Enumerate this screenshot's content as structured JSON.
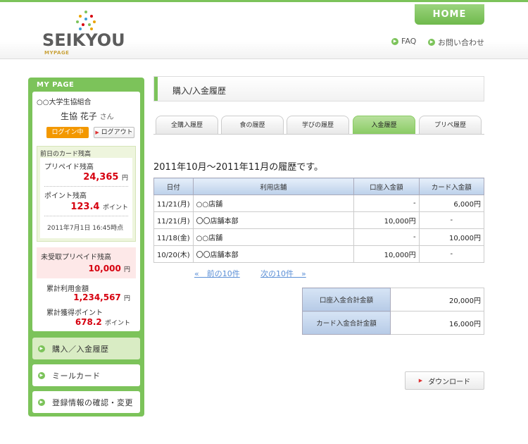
{
  "header": {
    "logo_text": "SEIKYOU",
    "logo_sub": "MYPAGE",
    "home": "HOME",
    "links": [
      "FAQ",
      "お問い合わせ"
    ]
  },
  "sidebar": {
    "title": "MY PAGE",
    "org": "○○大学生協組合",
    "user_name": "生協 花子",
    "user_suffix": "さん",
    "login_status": "ログイン中",
    "logout": "ログアウト",
    "prev_balance_title": "前日のカード残高",
    "prepaid_label": "プリペイド残高",
    "prepaid_value": "24,365",
    "prepaid_unit": "円",
    "point_label": "ポイント残高",
    "point_value": "123.4",
    "point_unit": "ポイント",
    "as_of": "2011年7月1日 16:45時点",
    "unreceived_label": "未受取プリペイド残高",
    "unreceived_value": "10,000",
    "unreceived_unit": "円",
    "total_use_label": "累計利用金額",
    "total_use_value": "1,234,567",
    "total_use_unit": "円",
    "total_points_label": "累計獲得ポイント",
    "total_points_value": "678.2",
    "total_points_unit": "ポイント",
    "nav": [
      "購入／入金履歴",
      "ミールカード",
      "登録情報の確認・変更"
    ]
  },
  "main": {
    "page_title": "購入/入金履歴",
    "tabs": [
      "全購入履歴",
      "食の履歴",
      "学びの履歴",
      "入金履歴",
      "プリペ履歴"
    ],
    "active_tab": 3,
    "period": "2011年10月～2011年11月の履歴です。",
    "columns": [
      "日付",
      "利用店舗",
      "口座入金額",
      "カード入金額"
    ],
    "rows": [
      [
        "11/21(月)",
        "○○店舗",
        "-",
        "6,000円"
      ],
      [
        "11/21(月)",
        "〇〇店舗本部",
        "10,000円",
        "-"
      ],
      [
        "11/18(金)",
        "○○店舗",
        "-",
        "10,000円"
      ],
      [
        "10/20(木)",
        "〇〇店舗本部",
        "10,000円",
        "-"
      ]
    ],
    "prev": "«　前の10件",
    "next": "次の10件　»",
    "total_account_label": "口座入金合計金額",
    "total_account_value": "20,000円",
    "total_card_label": "カード入金合計金額",
    "total_card_value": "16,000円",
    "download": "ダウンロード"
  },
  "colors": {
    "brand_green": "#7cc35a",
    "accent_red": "#d6000f",
    "badge_orange": "#f39800"
  }
}
